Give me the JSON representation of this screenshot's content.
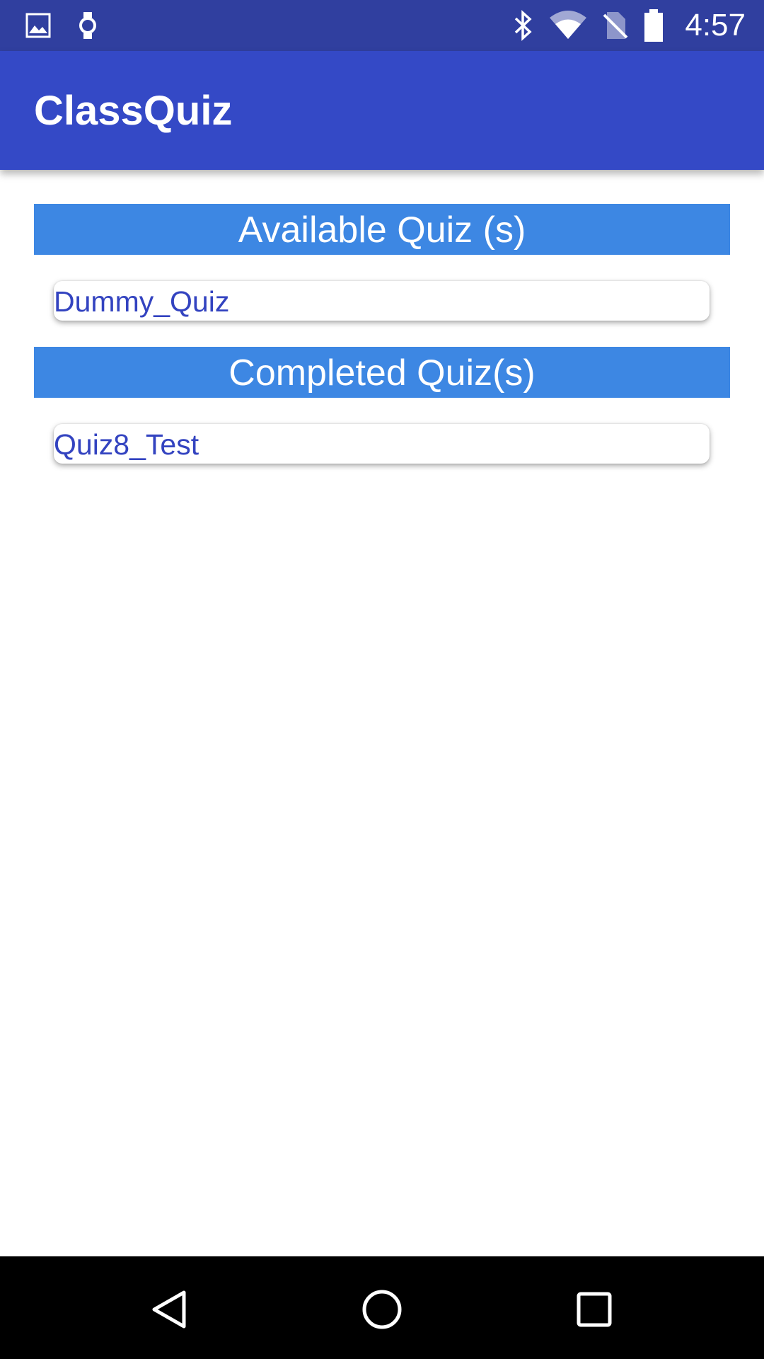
{
  "status_bar": {
    "time": "4:57",
    "left_icons": [
      "image-icon",
      "watch-icon"
    ],
    "right_icons": [
      "bluetooth-icon",
      "wifi-icon",
      "no-sim-icon",
      "battery-icon"
    ]
  },
  "app_bar": {
    "title": "ClassQuiz"
  },
  "available": {
    "header": "Available Quiz (s)",
    "items": [
      {
        "label": "Dummy_Quiz"
      }
    ]
  },
  "completed": {
    "header": "Completed Quiz(s)",
    "items": [
      {
        "label": "Quiz8_Test"
      }
    ]
  },
  "nav_bar": {
    "buttons": [
      "back-icon",
      "home-icon",
      "recents-icon"
    ]
  },
  "colors": {
    "status_bar": "#303f9f",
    "app_bar": "#3449c6",
    "section_header": "#3d87e3",
    "item_text": "#3343c0",
    "nav_bar": "#000000"
  }
}
